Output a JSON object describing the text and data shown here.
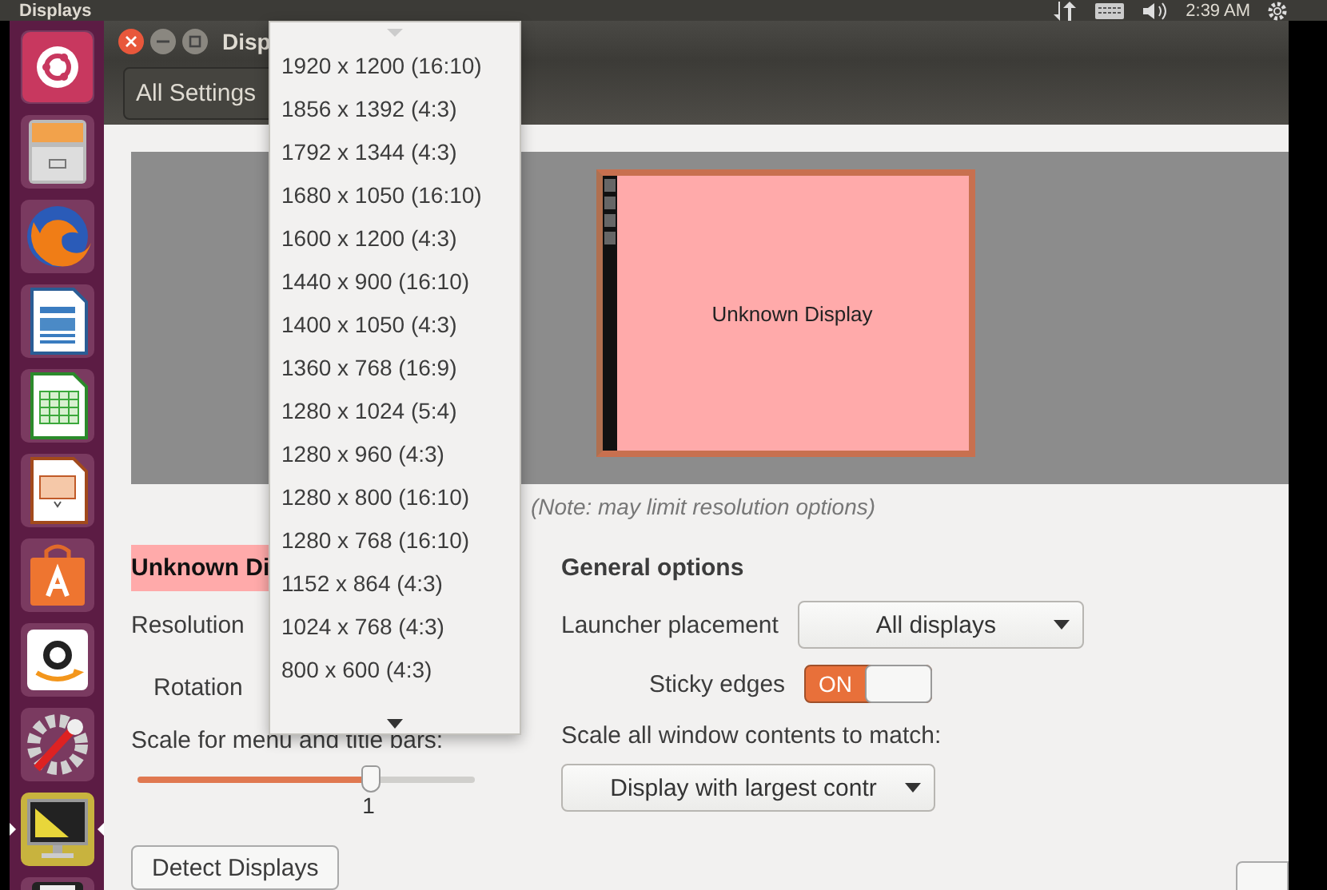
{
  "top_bar": {
    "title": "Displays",
    "time": "2:39 AM"
  },
  "launcher": {
    "items": [
      {
        "kind": "ubuntu",
        "selected": false
      },
      {
        "kind": "files",
        "selected": false
      },
      {
        "kind": "browser",
        "selected": false
      },
      {
        "kind": "writer",
        "selected": false
      },
      {
        "kind": "calc",
        "selected": false
      },
      {
        "kind": "impress",
        "selected": false
      },
      {
        "kind": "software",
        "selected": false
      },
      {
        "kind": "shop",
        "selected": false
      },
      {
        "kind": "settings",
        "selected": false
      },
      {
        "kind": "displays",
        "selected": true
      },
      {
        "kind": "disk",
        "selected": false
      }
    ]
  },
  "window": {
    "title": "Disp",
    "back_button": "All Settings"
  },
  "preview": {
    "display_label": "Unknown Display"
  },
  "note": "(Note: may limit resolution options)",
  "display_settings": {
    "heading": "Unknown Di",
    "resolution_label": "Resolution",
    "rotation_label": "Rotation",
    "scale_label": "Scale for menu and title bars:",
    "scale": {
      "level": 0.69,
      "reading": "1"
    },
    "detect_button": "Detect Displays"
  },
  "general_options": {
    "heading": "General options",
    "launcher_label": "Launcher placement",
    "launcher_value": "All displays",
    "sticky": {
      "label": "Sticky edges",
      "on": true,
      "state_text": "ON"
    },
    "scale_all_label": "Scale all window contents to match:",
    "scale_all_value": "Display with largest contr"
  },
  "resolution_menu": {
    "items": [
      {
        "label": "1920 x 1200 (16:10)"
      },
      {
        "label": "1856 x 1392 (4:3)"
      },
      {
        "label": "1792 x 1344 (4:3)"
      },
      {
        "label": "1680 x 1050 (16:10)"
      },
      {
        "label": "1600 x 1200 (4:3)"
      },
      {
        "label": "1440 x 900 (16:10)"
      },
      {
        "label": "1400 x 1050 (4:3)"
      },
      {
        "label": "1360 x 768 (16:9)"
      },
      {
        "label": "1280 x 1024 (5:4)"
      },
      {
        "label": "1280 x 960 (4:3)"
      },
      {
        "label": "1280 x 800 (16:10)"
      },
      {
        "label": "1280 x 768 (16:10)"
      },
      {
        "label": "1152 x 864 (4:3)"
      },
      {
        "label": "1024 x 768 (4:3)"
      },
      {
        "label": "800 x 600 (4:3)"
      }
    ]
  }
}
